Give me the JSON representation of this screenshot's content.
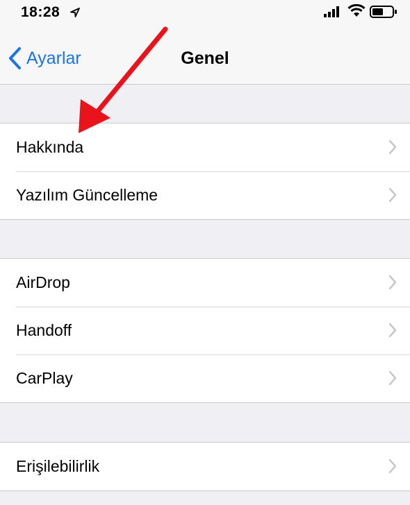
{
  "status_bar": {
    "time": "18:28"
  },
  "nav": {
    "back_label": "Ayarlar",
    "title": "Genel"
  },
  "groups": [
    {
      "rows": [
        {
          "label": "Hakkında"
        },
        {
          "label": "Yazılım Güncelleme"
        }
      ]
    },
    {
      "rows": [
        {
          "label": "AirDrop"
        },
        {
          "label": "Handoff"
        },
        {
          "label": "CarPlay"
        }
      ]
    },
    {
      "rows": [
        {
          "label": "Erişilebilirlik"
        }
      ]
    }
  ],
  "colors": {
    "accent": "#1a73e8",
    "background": "#efeff4",
    "cell": "#ffffff",
    "annotation_arrow": "#e8131b"
  },
  "icons": [
    "location-arrow-icon",
    "signal-icon",
    "wifi-icon",
    "battery-icon",
    "chevron-left-icon",
    "chevron-right-icon",
    "annotation-arrow"
  ]
}
